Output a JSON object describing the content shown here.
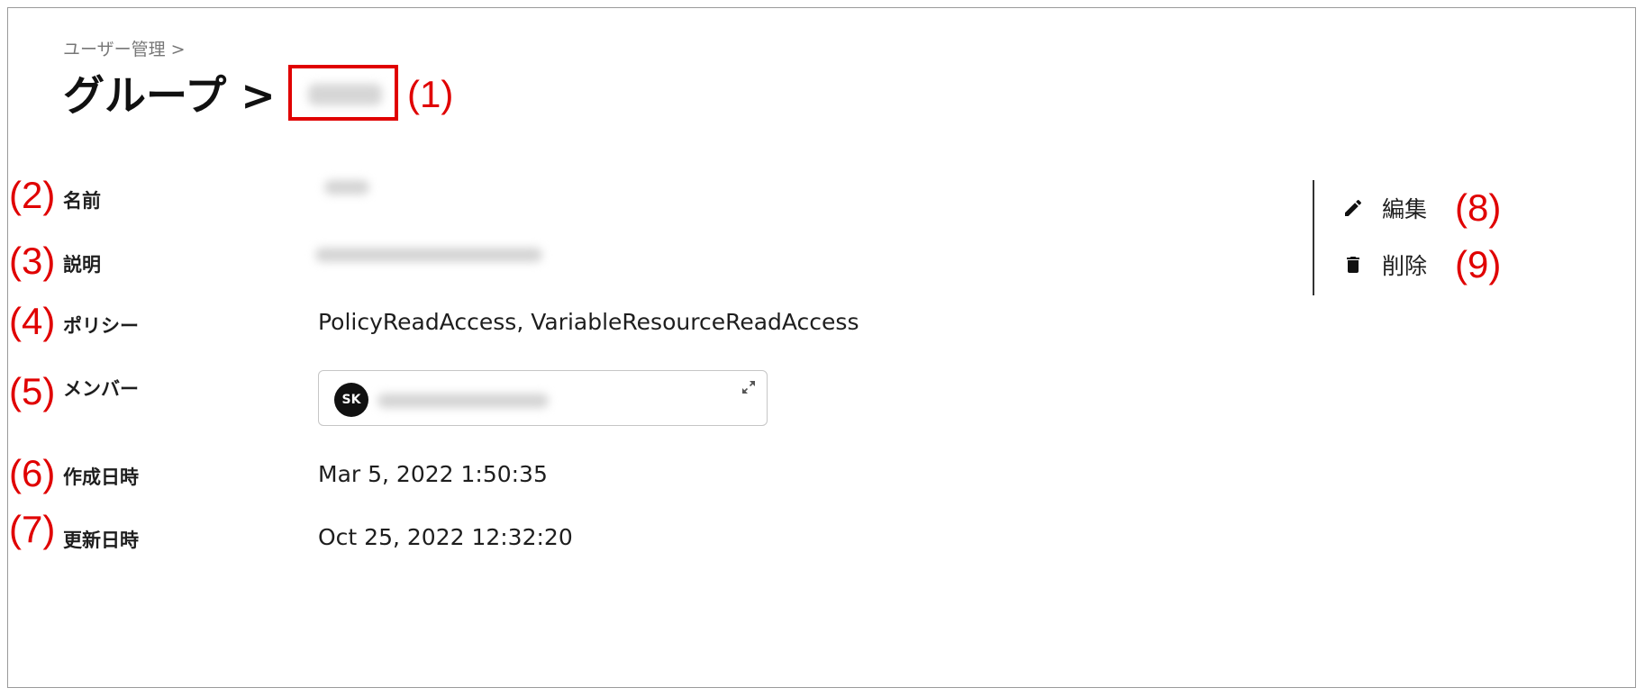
{
  "breadcrumb": "ユーザー管理 >",
  "title": {
    "prefix": "グループ >"
  },
  "annotations": {
    "a1": "(1)",
    "a2": "(2)",
    "a3": "(3)",
    "a4": "(4)",
    "a5": "(5)",
    "a6": "(6)",
    "a7": "(7)",
    "a8": "(8)",
    "a9": "(9)"
  },
  "fields": {
    "name_label": "名前",
    "description_label": "説明",
    "policy_label": "ポリシー",
    "policy_value": "PolicyReadAccess, VariableResourceReadAccess",
    "members_label": "メンバー",
    "member_initials": "SK",
    "created_label": "作成日時",
    "created_value": "Mar 5, 2022 1:50:35",
    "updated_label": "更新日時",
    "updated_value": "Oct 25, 2022 12:32:20"
  },
  "actions": {
    "edit_label": "編集",
    "delete_label": "削除"
  },
  "icons": {
    "edit": "pencil-icon",
    "delete": "trash-icon",
    "expand": "expand-icon"
  },
  "colors": {
    "annotation": "#e00000",
    "avatar_bg": "#111111"
  }
}
